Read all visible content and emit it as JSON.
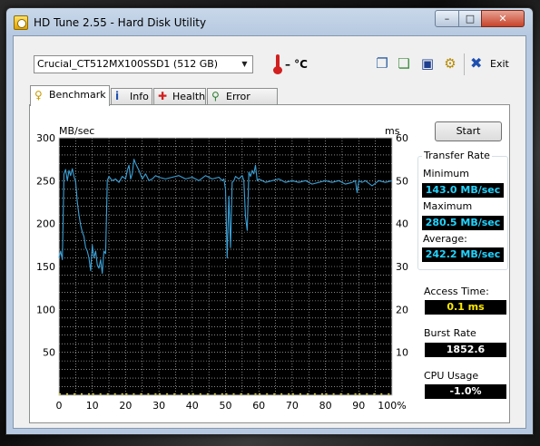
{
  "window": {
    "title": "HD Tune 2.55 - Hard Disk Utility",
    "controls": {
      "minimize": "–",
      "maximize": "□",
      "close": "✕"
    }
  },
  "toolbar": {
    "drive": "Crucial_CT512MX100SSD1 (512 GB)",
    "temperature": "– °C",
    "exit_label": "Exit",
    "icons": [
      "copy-icon",
      "copy-screenshot-icon",
      "save-icon",
      "options-icon",
      "exit-icon"
    ]
  },
  "tabs": [
    {
      "label": "Benchmark",
      "icon": "benchmark-icon",
      "active": true
    },
    {
      "label": "Info",
      "icon": "info-icon",
      "active": false
    },
    {
      "label": "Health",
      "icon": "health-icon",
      "active": false
    },
    {
      "label": "Error Scan",
      "icon": "error-scan-icon",
      "active": false
    }
  ],
  "benchmark": {
    "start_label": "Start",
    "transfer_rate_title": "Transfer Rate",
    "minimum_label": "Minimum",
    "minimum_value": "143.0 MB/sec",
    "maximum_label": "Maximum",
    "maximum_value": "280.5 MB/sec",
    "average_label": "Average:",
    "average_value": "242.2 MB/sec",
    "access_time_label": "Access Time:",
    "access_time_value": "0.1 ms",
    "burst_rate_label": "Burst Rate",
    "burst_rate_value": "1852.6 MB/sec",
    "cpu_usage_label": "CPU Usage",
    "cpu_usage_value": "-1.0%"
  },
  "chart_data": {
    "type": "line",
    "ylabel_left": "MB/sec",
    "ylabel_right": "ms",
    "ylim_left": [
      0,
      300
    ],
    "ylim_right": [
      0,
      60
    ],
    "xlim": [
      0,
      100
    ],
    "yticks_left": [
      "300",
      "250",
      "200",
      "150",
      "100",
      "50"
    ],
    "yticks_right": [
      "60",
      "50",
      "40",
      "30",
      "20",
      "10"
    ],
    "xticks": [
      "0",
      "10",
      "20",
      "30",
      "40",
      "50",
      "60",
      "70",
      "80",
      "90",
      "100%"
    ],
    "grid": true,
    "colors": {
      "background": "#000000",
      "grid": "#d6d6d6",
      "transfer": "#3aa0d6",
      "access": "#e8e000"
    },
    "series": [
      {
        "axis": "left",
        "x": [
          0,
          0.5,
          1,
          1.5,
          2,
          2.5,
          3,
          3.5,
          4,
          4.5,
          5,
          5.5,
          6,
          6.5,
          7,
          7.5,
          8,
          8.5,
          9,
          9.5,
          10,
          10.5,
          11,
          11.5,
          12,
          12.5,
          13,
          13.5,
          14,
          14.5,
          15,
          16,
          17,
          18,
          19,
          20,
          20.5,
          21,
          21.5,
          22,
          22.5,
          23,
          24,
          25,
          26,
          27,
          28,
          29,
          30,
          32,
          34,
          36,
          38,
          40,
          42,
          44,
          46,
          48,
          49,
          49.5,
          50,
          50.5,
          51,
          51.5,
          52,
          52.5,
          53,
          54,
          55,
          55.5,
          56,
          56.5,
          57,
          57.5,
          58,
          58.5,
          59,
          59.5,
          60,
          61,
          62,
          64,
          66,
          68,
          70,
          72,
          74,
          76,
          78,
          80,
          82,
          84,
          86,
          88,
          89,
          89.5,
          90,
          91,
          92,
          94,
          96,
          98,
          100
        ],
        "y": [
          160,
          168,
          158,
          258,
          263,
          250,
          262,
          256,
          264,
          255,
          248,
          225,
          210,
          198,
          190,
          185,
          172,
          168,
          160,
          145,
          175,
          160,
          168,
          152,
          148,
          158,
          142,
          168,
          165,
          250,
          255,
          250,
          252,
          248,
          255,
          252,
          262,
          268,
          252,
          258,
          275,
          270,
          262,
          252,
          258,
          250,
          252,
          256,
          254,
          252,
          254,
          256,
          252,
          254,
          250,
          256,
          252,
          254,
          250,
          252,
          240,
          160,
          232,
          172,
          248,
          250,
          255,
          252,
          256,
          250,
          208,
          192,
          260,
          255,
          262,
          258,
          268,
          250,
          252,
          250,
          248,
          250,
          252,
          248,
          250,
          248,
          250,
          246,
          248,
          250,
          248,
          250,
          246,
          248,
          250,
          236,
          250,
          248,
          250,
          244,
          250,
          248,
          250
        ]
      },
      {
        "axis": "right",
        "x": [
          0,
          10,
          20,
          30,
          40,
          50,
          60,
          70,
          80,
          90,
          100
        ],
        "y": [
          0.1,
          0.1,
          0.1,
          0.1,
          0.1,
          0.1,
          0.1,
          0.1,
          0.1,
          0.1,
          0.1
        ]
      }
    ]
  }
}
